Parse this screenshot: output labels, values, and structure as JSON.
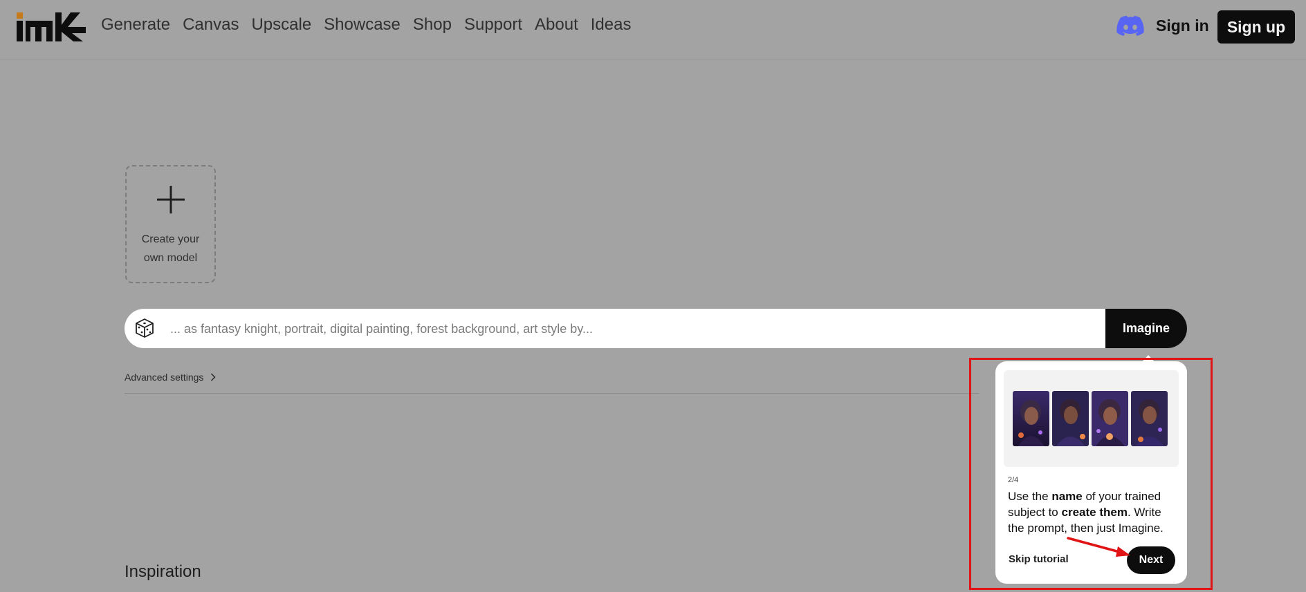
{
  "header": {
    "nav": [
      "Generate",
      "Canvas",
      "Upscale",
      "Showcase",
      "Shop",
      "Support",
      "About",
      "Ideas"
    ],
    "signin_label": "Sign in",
    "signup_label": "Sign up"
  },
  "create_model": {
    "label": "Create your own model"
  },
  "prompt": {
    "placeholder": "... as fantasy knight, portrait, digital painting, forest background, art style by...",
    "value": "",
    "imagine_label": "Imagine"
  },
  "advanced_label": "Advanced settings",
  "inspiration_label": "Inspiration",
  "tutorial": {
    "step": "2/4",
    "text_1": "Use the ",
    "text_bold_1": "name",
    "text_2": " of your trained subject to ",
    "text_bold_2": "create them",
    "text_3": ". Write the prompt, then just Imagine.",
    "skip_label": "Skip tutorial",
    "next_label": "Next"
  },
  "icons": {
    "logo": "brand-logo",
    "discord": "discord-icon",
    "plus": "plus-icon",
    "dice": "dice-icon",
    "chevron": "chevron-right-icon"
  },
  "colors": {
    "overlay_bg": "#a3a3a3",
    "dark_button": "#0d0d0d",
    "discord": "#5865f2",
    "highlight": "#e01414",
    "logo_accent": "#c77a1a"
  }
}
